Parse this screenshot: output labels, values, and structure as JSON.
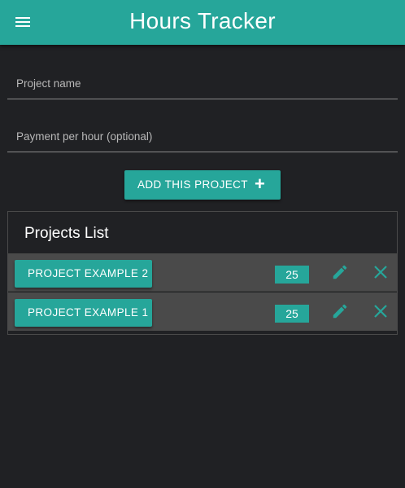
{
  "header": {
    "title": "Hours Tracker",
    "menu_icon": "hamburger-menu-icon",
    "color": "#26a69a"
  },
  "form": {
    "project_name_placeholder": "Project name",
    "payment_placeholder": "Payment per hour (optional)",
    "project_name_value": "",
    "payment_value": "",
    "add_button_label": "ADD THIS PROJECT",
    "add_button_icon": "+"
  },
  "projects_list": {
    "title": "Projects List",
    "items": [
      {
        "name": "PROJECT EXAMPLE 2",
        "rate": "25",
        "edit_icon": "pencil-icon",
        "delete_icon": "close-icon"
      },
      {
        "name": "PROJECT EXAMPLE 1",
        "rate": "25",
        "edit_icon": "pencil-icon",
        "delete_icon": "close-icon"
      }
    ]
  },
  "colors": {
    "accent": "#26a69a",
    "background": "#202124",
    "row": "#4a4a4a"
  }
}
